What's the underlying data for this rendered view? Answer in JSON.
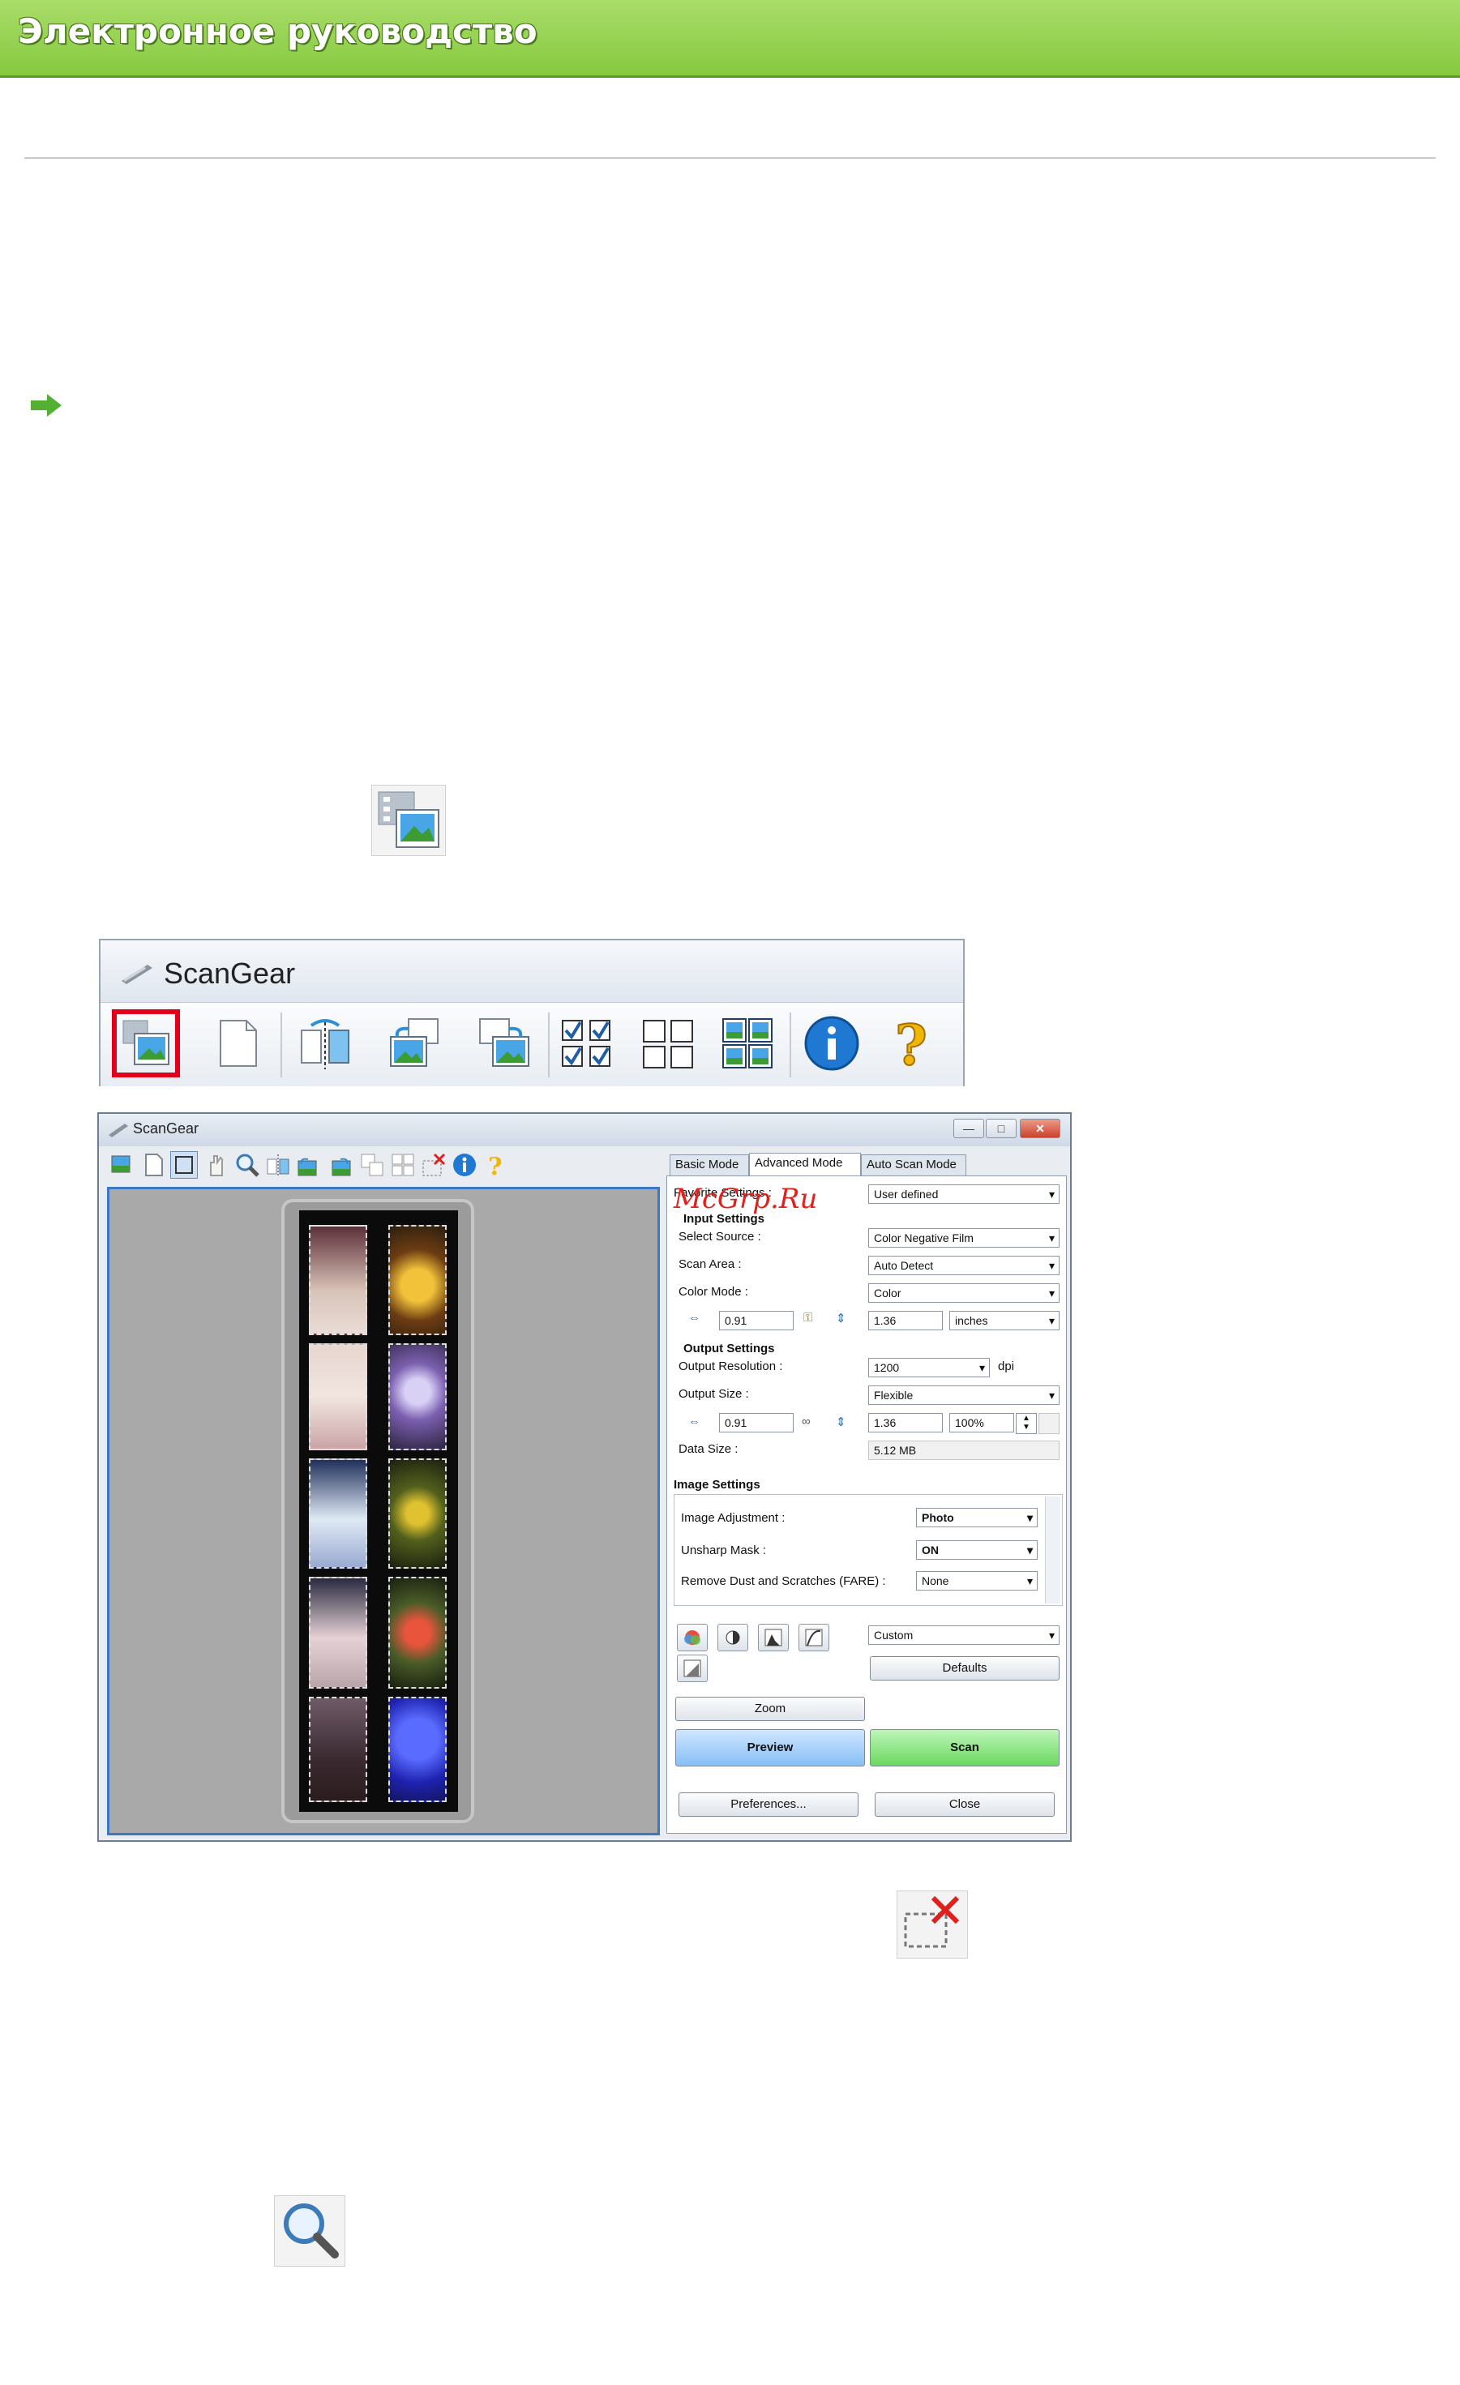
{
  "header": {
    "title": "Электронное руководство"
  },
  "toolbar_image": {
    "app_title": "ScanGear",
    "buttons": [
      "thumbnail-icon",
      "whole-image-icon",
      "mirror-icon",
      "rotate-left-icon",
      "rotate-right-icon",
      "select-all-frames-icon",
      "deselect-frames-icon",
      "auto-crop-icon",
      "info-icon",
      "help-icon"
    ]
  },
  "window": {
    "title": "ScanGear",
    "controls": {
      "minimize": "—",
      "maximize": "□",
      "close": "✕"
    },
    "tabs": [
      "Basic Mode",
      "Advanced Mode",
      "Auto Scan Mode"
    ],
    "watermark": "McGrp.Ru",
    "favorite_settings": {
      "label": "Favorite Settings :",
      "value": "User defined"
    },
    "input_settings": {
      "title": "Input Settings",
      "select_source": {
        "label": "Select Source :",
        "value": "Color Negative Film"
      },
      "scan_area": {
        "label": "Scan Area :",
        "value": "Auto Detect"
      },
      "color_mode": {
        "label": "Color Mode :",
        "value": "Color"
      },
      "width": "0.91",
      "height": "1.36",
      "unit": "inches"
    },
    "output_settings": {
      "title": "Output Settings",
      "resolution": {
        "label": "Output Resolution :",
        "value": "1200",
        "unit": "dpi"
      },
      "size": {
        "label": "Output Size :",
        "value": "Flexible"
      },
      "width": "0.91",
      "height": "1.36",
      "scale": "100%",
      "data_size": {
        "label": "Data Size :",
        "value": "5.12 MB"
      }
    },
    "image_settings": {
      "title": "Image Settings",
      "image_adjustment": {
        "label": "Image Adjustment :",
        "value": "Photo"
      },
      "unsharp_mask": {
        "label": "Unsharp Mask :",
        "value": "ON"
      },
      "dust": {
        "label": "Remove Dust and Scratches (FARE) :",
        "value": "None"
      }
    },
    "color_preset": "Custom",
    "buttons": {
      "defaults": "Defaults",
      "zoom": "Zoom",
      "preview": "Preview",
      "scan": "Scan",
      "preferences": "Preferences...",
      "close": "Close"
    }
  },
  "colors": {
    "header_green": "#86c93f",
    "selection_red": "#e3001b",
    "scan_green": "#69d95f",
    "preview_blue": "#86bff6"
  }
}
